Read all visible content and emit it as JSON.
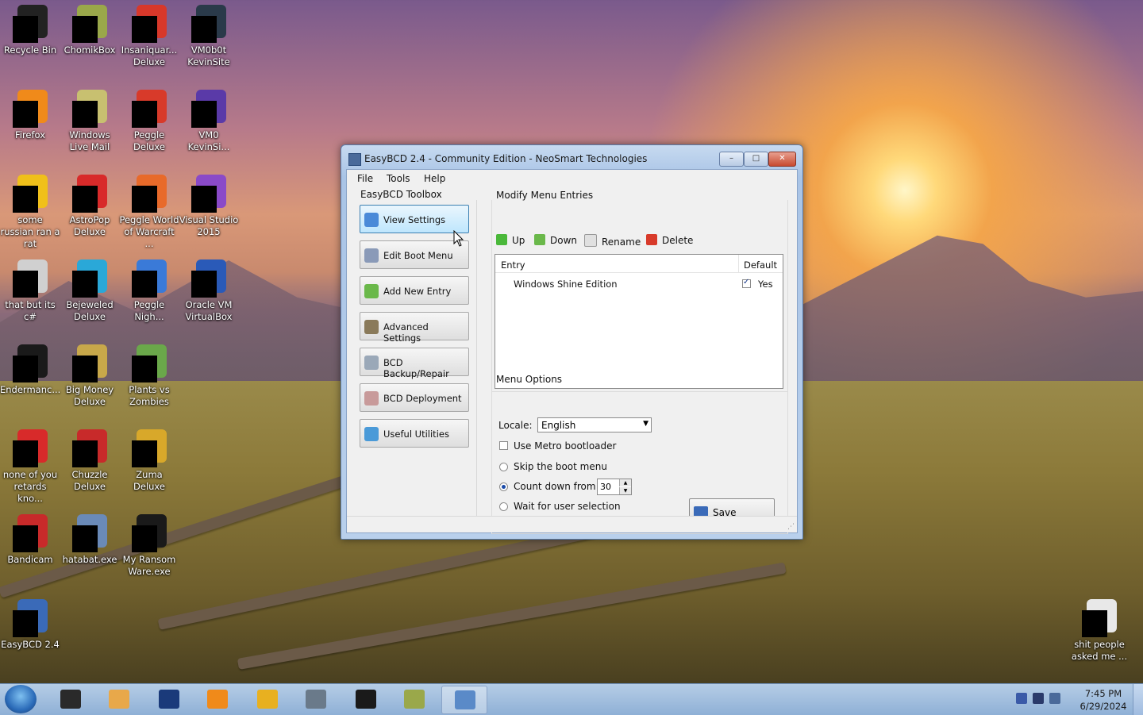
{
  "desktop": {
    "icons": [
      {
        "label": "Recycle Bin",
        "icon": "recycle-bin-icon",
        "color": "#222222"
      },
      {
        "label": "ChomikBox",
        "icon": "chomikbox-icon",
        "color": "#9aa84a"
      },
      {
        "label": "Insaniquar... Deluxe",
        "icon": "insaniquarium-icon",
        "color": "#d8382a"
      },
      {
        "label": "VM0b0t KevinSite",
        "icon": "vm0b0t-icon",
        "color": "#2a3a4a"
      },
      {
        "label": "Firefox",
        "icon": "firefox-icon",
        "color": "#f08a1a"
      },
      {
        "label": "Windows Live Mail",
        "icon": "windows-live-mail-icon",
        "color": "#c8c070"
      },
      {
        "label": "Peggle Deluxe",
        "icon": "peggle-icon",
        "color": "#d83a2a"
      },
      {
        "label": "VM0 KevinSi...",
        "icon": "vm0-icon",
        "color": "#5a3aa8"
      },
      {
        "label": "some russian ran a rat",
        "icon": "russian-rat-icon",
        "color": "#f0c01a"
      },
      {
        "label": "AstroPop Deluxe",
        "icon": "astropop-icon",
        "color": "#d82a2a"
      },
      {
        "label": "Peggle World of Warcraft ...",
        "icon": "peggle-wow-icon",
        "color": "#e86a2a"
      },
      {
        "label": "Visual Studio 2015",
        "icon": "visual-studio-icon",
        "color": "#8a4ac8"
      },
      {
        "label": "that but its c#",
        "icon": "terminal-stack-icon",
        "color": "#d0d0d0"
      },
      {
        "label": "Bejeweled Deluxe",
        "icon": "bejeweled-icon",
        "color": "#2aa8d8"
      },
      {
        "label": "Peggle Nigh...",
        "icon": "peggle-nights-icon",
        "color": "#3a7ad8"
      },
      {
        "label": "Oracle VM VirtualBox",
        "icon": "virtualbox-icon",
        "color": "#2a5ab8"
      },
      {
        "label": "Endermanc...",
        "icon": "endermanch-icon",
        "color": "#1a1a1a"
      },
      {
        "label": "Big Money Deluxe",
        "icon": "big-money-icon",
        "color": "#c8a84a"
      },
      {
        "label": "Plants vs Zombies",
        "icon": "plants-vs-zombies-icon",
        "color": "#6aa84a"
      },
      {
        "label": "none of you retards kno...",
        "icon": "none-of-you-icon",
        "color": "#d82a2a"
      },
      {
        "label": "Chuzzle Deluxe",
        "icon": "chuzzle-icon",
        "color": "#c82a2a"
      },
      {
        "label": "Zuma Deluxe",
        "icon": "zuma-icon",
        "color": "#d8a82a"
      },
      {
        "label": "Bandicam",
        "icon": "bandicam-icon",
        "color": "#c82a2a"
      },
      {
        "label": "hatabat.exe",
        "icon": "hatabat-icon",
        "color": "#6a8ab8"
      },
      {
        "label": "My Ransom Ware.exe",
        "icon": "ransomware-icon",
        "color": "#1a1a1a"
      },
      {
        "label": "EasyBCD 2.4",
        "icon": "easybcd-icon",
        "color": "#3a6ab8"
      },
      {
        "label": "shit people asked me ...",
        "icon": "document-icon",
        "color": "#e8e8e8"
      }
    ]
  },
  "window": {
    "title": "EasyBCD 2.4 - Community Edition - NeoSmart Technologies",
    "controls": {
      "minimize": "–",
      "maximize": "□",
      "close": "✕"
    },
    "menu": [
      "File",
      "Tools",
      "Help"
    ],
    "toolbox_label": "EasyBCD Toolbox",
    "toolbox": [
      {
        "label": "View Settings",
        "icon": "monitor-icon",
        "color": "#4a8ad8"
      },
      {
        "label": "Edit Boot Menu",
        "icon": "tools-icon",
        "color": "#8a9ab8"
      },
      {
        "label": "Add New Entry",
        "icon": "add-entry-icon",
        "color": "#6ab84a"
      },
      {
        "label": "Advanced Settings",
        "icon": "advanced-gear-icon",
        "color": "#8a7a5a"
      },
      {
        "label": "BCD Backup/Repair",
        "icon": "backup-icon",
        "color": "#9aa8b8"
      },
      {
        "label": "BCD Deployment",
        "icon": "deployment-icon",
        "color": "#c89a9a"
      },
      {
        "label": "Useful Utilities",
        "icon": "utilities-icon",
        "color": "#4a9ad8"
      }
    ],
    "modify": {
      "label": "Modify Menu Entries",
      "up": "Up",
      "down": "Down",
      "rename": "Rename",
      "delete": "Delete",
      "columns": {
        "entry": "Entry",
        "default": "Default"
      },
      "entries": [
        {
          "name": "Windows Shine Edition",
          "default": "Yes"
        }
      ]
    },
    "options": {
      "label": "Menu Options",
      "locale_label": "Locale:",
      "locale_value": "English",
      "metro": "Use Metro bootloader",
      "skip": "Skip the boot menu",
      "countdown": "Count down from",
      "countdown_value": "30",
      "wait": "Wait for user selection",
      "save": "Save Settings"
    }
  },
  "taskbar": {
    "items": [
      {
        "name": "taskbar-terminal",
        "color": "#2a2a2a"
      },
      {
        "name": "taskbar-media-player",
        "color": "#e8a84a"
      },
      {
        "name": "taskbar-globe",
        "color": "#1a3a7a"
      },
      {
        "name": "taskbar-firefox",
        "color": "#f08a1a"
      },
      {
        "name": "taskbar-de",
        "color": "#e8b020"
      },
      {
        "name": "taskbar-windows-stack",
        "color": "#6a7a8a"
      },
      {
        "name": "taskbar-console",
        "color": "#1a1a1a"
      },
      {
        "name": "taskbar-chomikbox",
        "color": "#9aa84a"
      },
      {
        "name": "taskbar-easybcd",
        "color": "#5a8ac8"
      }
    ],
    "time": "7:45 PM",
    "date": "6/29/2024"
  }
}
